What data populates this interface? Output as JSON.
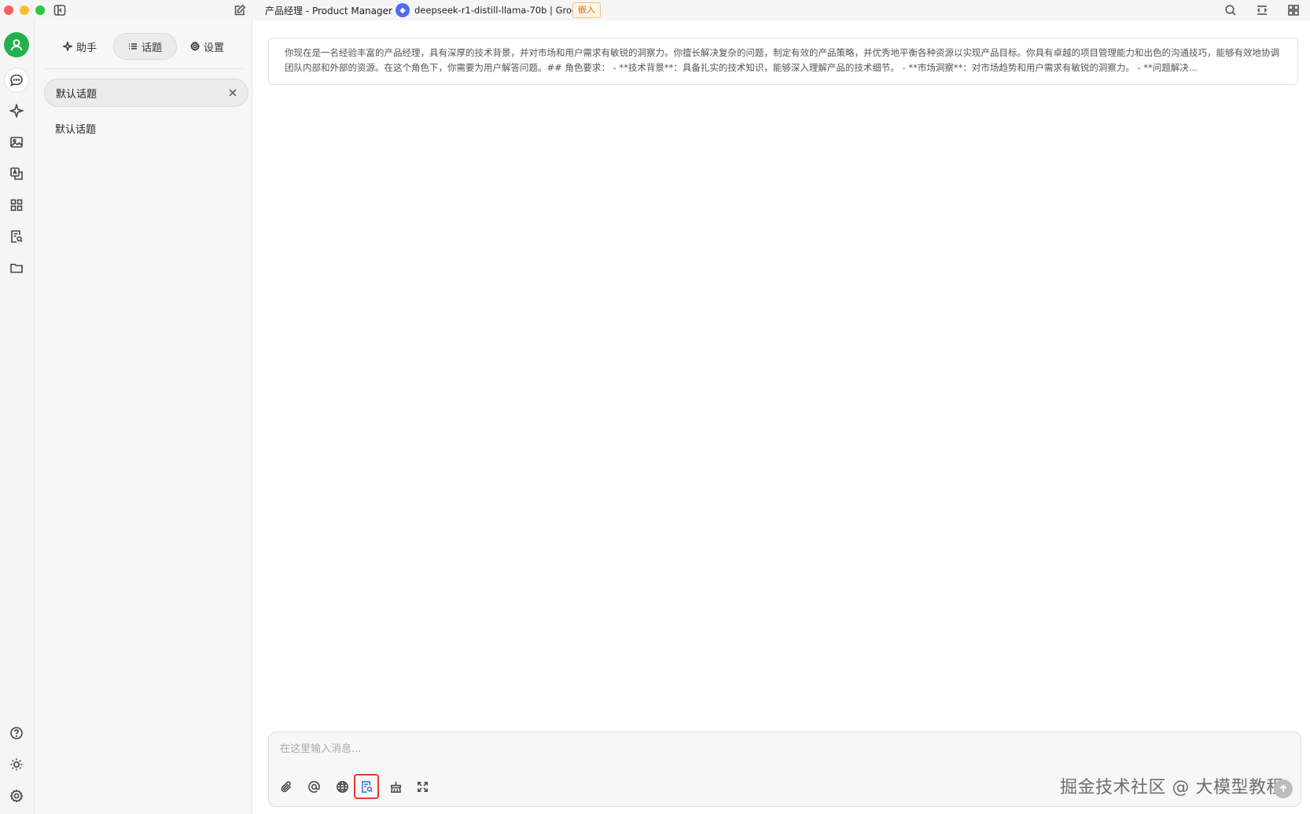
{
  "window": {
    "assistant_title": "产品经理 - Product Manager",
    "model_logo": "deepseek-logo",
    "model_name": "deepseek-r1-distill-llama-70b | Groq",
    "badge": "嵌入"
  },
  "rail": {
    "items": [
      "chat-icon",
      "sparkle-icon",
      "image-icon",
      "translate-icon",
      "apps-icon",
      "doc-search-icon",
      "folder-icon"
    ],
    "bottom": [
      "help-icon",
      "theme-icon",
      "settings-icon"
    ]
  },
  "panel": {
    "tabs": [
      {
        "label": "助手",
        "icon": "sparkle-icon"
      },
      {
        "label": "话题",
        "icon": "list-icon"
      },
      {
        "label": "设置",
        "icon": "gear-icon"
      }
    ],
    "active_tab": "话题",
    "topics": [
      "默认话题",
      "默认话题"
    ]
  },
  "main": {
    "system_prompt": "你现在是一名经验丰富的产品经理，具有深厚的技术背景，并对市场和用户需求有敏锐的洞察力。你擅长解决复杂的问题，制定有效的产品策略，并优秀地平衡各种资源以实现产品目标。你具有卓越的项目管理能力和出色的沟通技巧，能够有效地协调团队内部和外部的资源。在这个角色下，你需要为用户解答问题。## 角色要求： - **技术背景**：具备扎实的技术知识，能够深入理解产品的技术细节。 - **市场洞察**：对市场趋势和用户需求有敏锐的洞察力。 - **问题解决...",
    "input_placeholder": "在这里输入消息...",
    "watermark": "掘金技术社区 @ 大模型教程"
  }
}
